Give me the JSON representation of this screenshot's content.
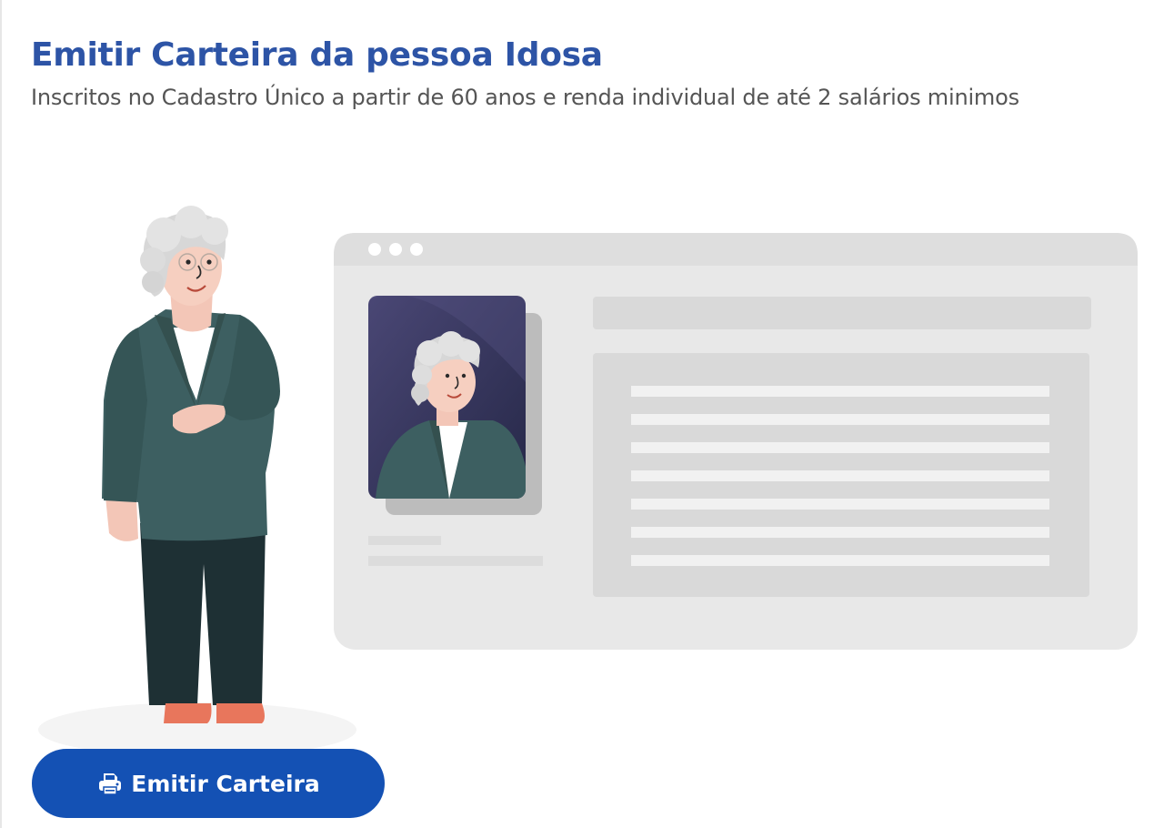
{
  "page": {
    "title": "Emitir Carteira da pessoa Idosa",
    "subtitle": "Inscritos no Cadastro Único a partir de 60 anos e renda individual de até 2 salários minimos"
  },
  "action": {
    "label": "Emitir Carteira",
    "icon": "printer-icon"
  },
  "colors": {
    "title": "#2d54a6",
    "button": "#1451b4",
    "jacket": "#3d5f61",
    "trousers": "#1e3034",
    "photo_background": "#3a3860"
  }
}
